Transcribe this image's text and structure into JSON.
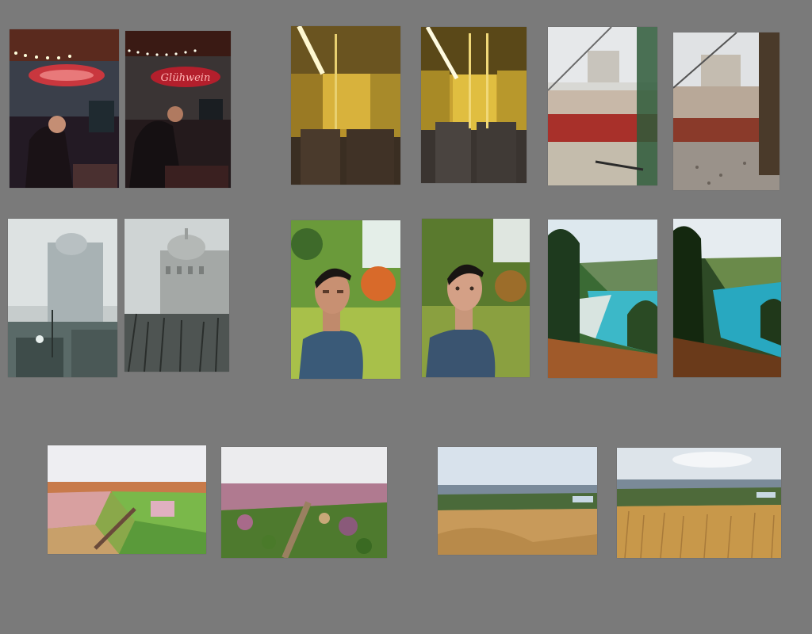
{
  "canvas": {
    "background": "#7a7a7a"
  },
  "pairs": [
    {
      "name": "market-stall",
      "study": "painted-study",
      "reference": "photo-reference",
      "sign_text": "Glühwein"
    },
    {
      "name": "tram-interior",
      "study": "painted-study",
      "reference": "photo-reference"
    },
    {
      "name": "shipwreck",
      "study": "painted-study",
      "reference": "photo-reference"
    },
    {
      "name": "foggy-building",
      "study": "painted-study",
      "reference": "photo-reference"
    },
    {
      "name": "portrait",
      "study": "painted-study",
      "reference": "photo-reference"
    },
    {
      "name": "coastal-cove",
      "study": "painted-study",
      "reference": "photo-reference"
    },
    {
      "name": "heather-moor",
      "study": "painted-study",
      "reference": "photo-reference"
    },
    {
      "name": "grassland-vista",
      "study": "painted-study",
      "reference": "photo-reference"
    }
  ]
}
